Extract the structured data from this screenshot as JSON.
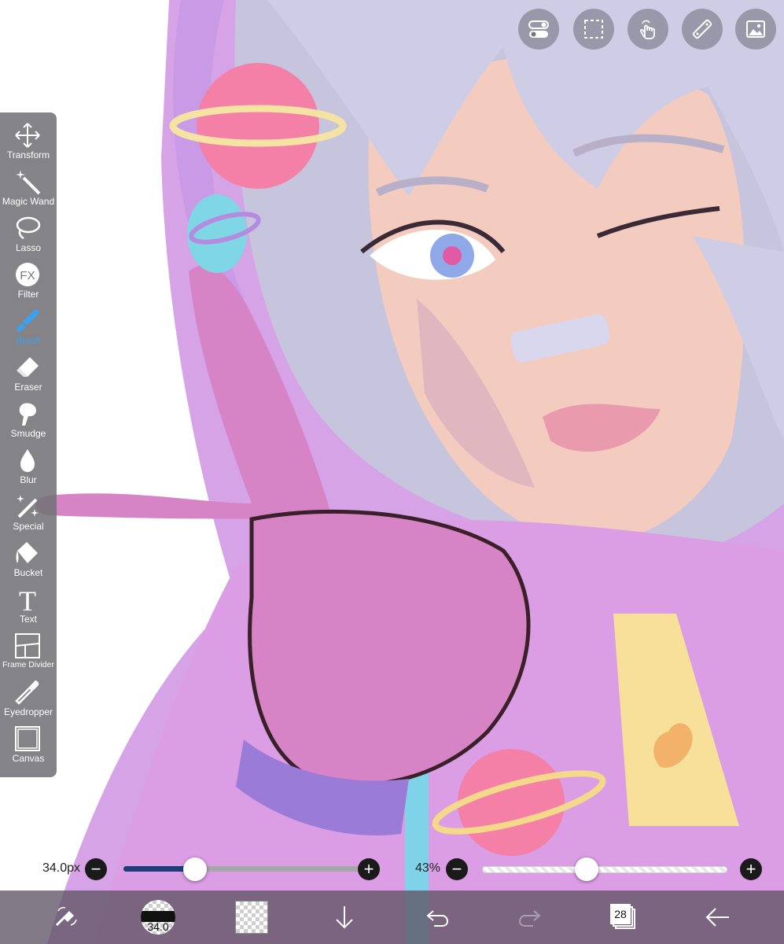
{
  "toolbar": {
    "items": [
      {
        "label": "Transform",
        "icon": "transform-icon"
      },
      {
        "label": "Magic Wand",
        "icon": "magic-wand-icon"
      },
      {
        "label": "Lasso",
        "icon": "lasso-icon"
      },
      {
        "label": "Filter",
        "icon": "fx-icon",
        "glyph": "FX"
      },
      {
        "label": "Brush",
        "icon": "brush-icon",
        "active": true
      },
      {
        "label": "Eraser",
        "icon": "eraser-icon"
      },
      {
        "label": "Smudge",
        "icon": "smudge-icon"
      },
      {
        "label": "Blur",
        "icon": "blur-drop-icon"
      },
      {
        "label": "Special",
        "icon": "special-icon"
      },
      {
        "label": "Bucket",
        "icon": "bucket-icon"
      },
      {
        "label": "Text",
        "icon": "text-icon",
        "glyph": "T"
      },
      {
        "label": "Frame Divider",
        "icon": "frame-divider-icon"
      },
      {
        "label": "Eyedropper",
        "icon": "eyedropper-icon"
      },
      {
        "label": "Canvas",
        "icon": "canvas-icon"
      }
    ],
    "active_color": "#3aa0f0"
  },
  "top_tools": [
    "toggle-icon",
    "selection-icon",
    "hand-gesture-icon",
    "ruler-icon",
    "material-icon"
  ],
  "brush_size": {
    "label": "34.0px",
    "value": 34.0,
    "fraction": 0.3
  },
  "opacity": {
    "label": "43%",
    "value": 43,
    "fraction": 0.43
  },
  "bottom_bar": {
    "brush_size_badge": "34.0",
    "layer_count": "28"
  },
  "colors": {
    "accent": "#3aa0f0",
    "toolbar_bg": "#737378",
    "hair": "#c8c6df",
    "skin": "#f3c8bf",
    "jacket": "#d99ae0"
  }
}
